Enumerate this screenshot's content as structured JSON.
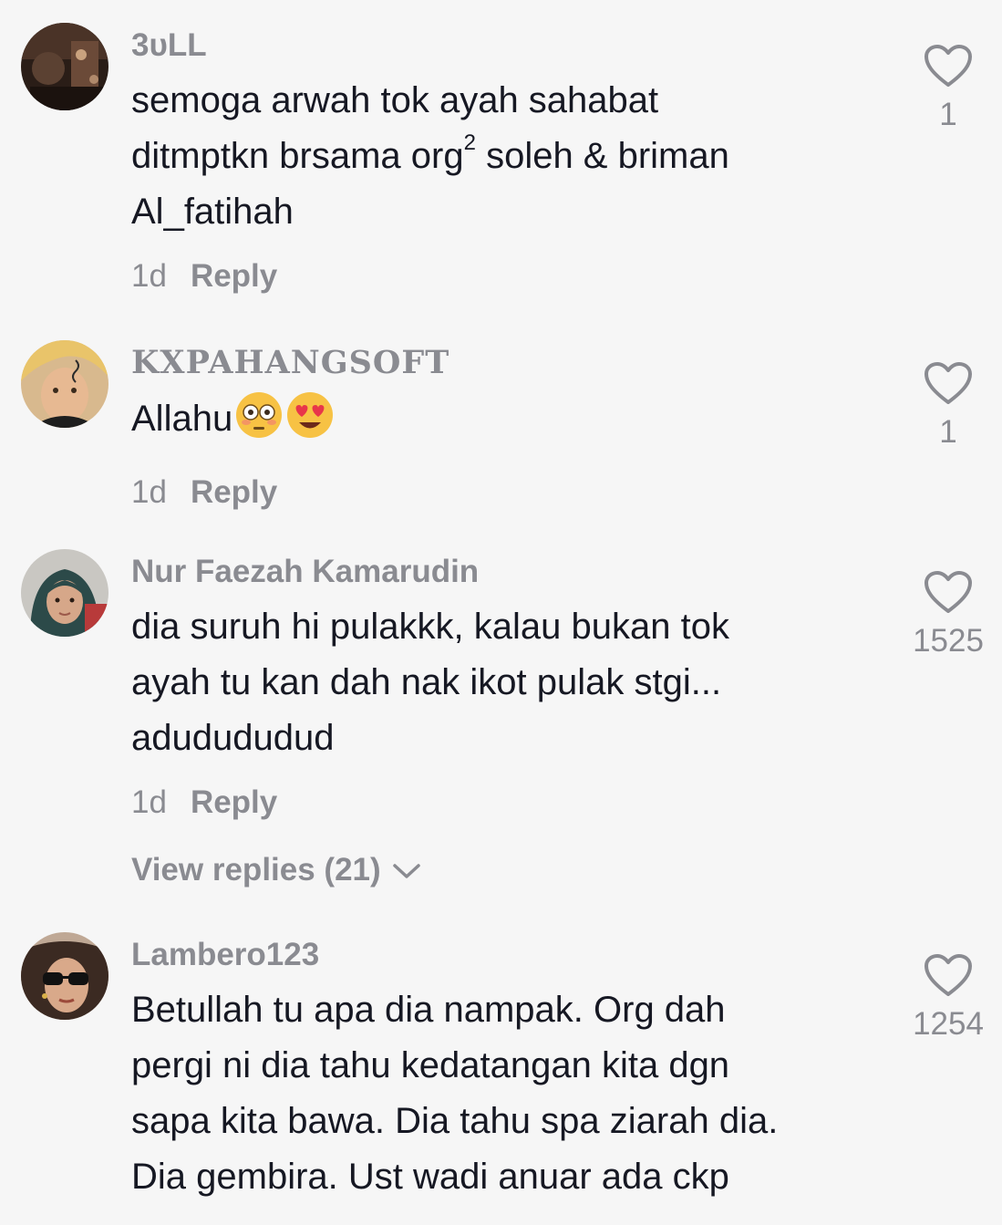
{
  "comments": [
    {
      "username": "3ᴜLL",
      "text_line1": "semoga arwah tok ayah sahabat",
      "text_line2a": "ditmptkn brsama org",
      "text_line2_sup": "2",
      "text_line2b": " soleh & briman",
      "text_line3": "Al_fatihah",
      "time": "1d",
      "reply_label": "Reply",
      "likes": "1"
    },
    {
      "username": "KⅩPAHANGSOFT",
      "text": "Allahu",
      "emojis": [
        "flushed-face-emoji",
        "heart-eyes-emoji"
      ],
      "time": "1d",
      "reply_label": "Reply",
      "likes": "1"
    },
    {
      "username": "Nur Faezah Kamarudin",
      "text_line1": "dia suruh hi pulakkk, kalau bukan tok",
      "text_line2": "ayah tu kan dah nak ikot pulak stgi...",
      "text_line3": "adudududud",
      "time": "1d",
      "reply_label": "Reply",
      "view_replies": "View replies (21)",
      "likes": "1525"
    },
    {
      "username": "Lambero123",
      "text_line1": "Betullah tu apa dia nampak. Org dah",
      "text_line2": "pergi ni dia tahu kedatangan kita dgn",
      "text_line3": "sapa kita bawa. Dia tahu spa ziarah dia.",
      "text_line4": "Dia gembira. Ust wadi anuar ada ckp",
      "likes": "1254"
    }
  ],
  "colors": {
    "background": "#f6f6f6",
    "text": "#161823",
    "secondary": "#8a8b91"
  },
  "icons": {
    "like": "heart-outline-icon",
    "expand": "chevron-down-icon"
  }
}
